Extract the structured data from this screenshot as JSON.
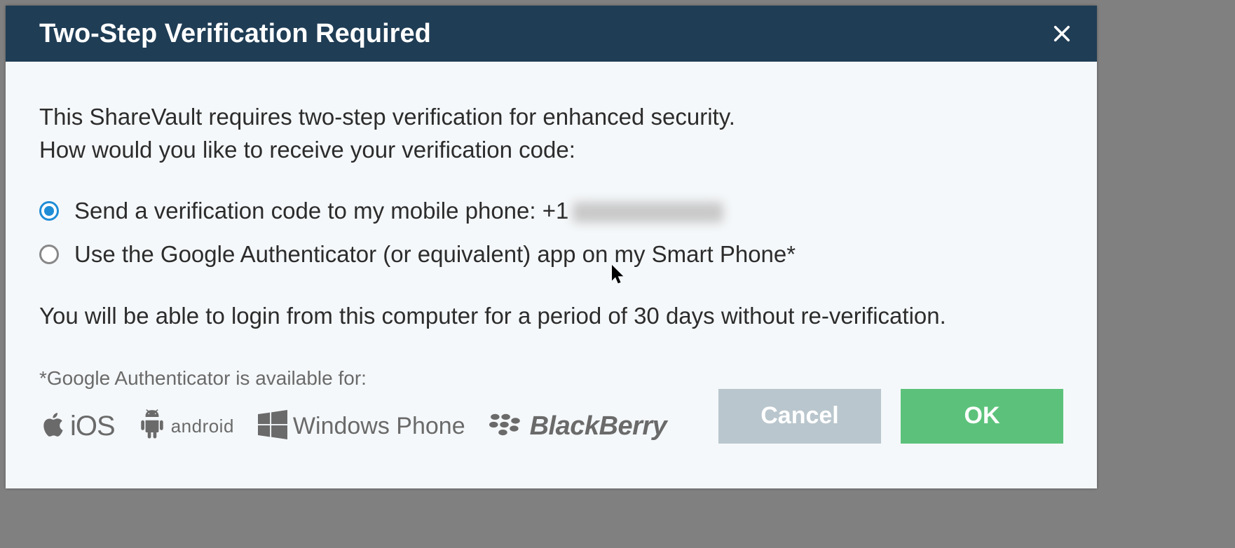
{
  "dialog": {
    "title": "Two-Step Verification Required",
    "intro_line1": "This ShareVault requires two-step verification for enhanced security.",
    "intro_line2": "How would you like to receive your verification code:",
    "options": {
      "sms": {
        "label_prefix": "Send a verification code to my mobile phone: ",
        "phone_prefix": "+1",
        "selected": true
      },
      "authenticator": {
        "label": "Use the Google Authenticator (or equivalent) app on my Smart Phone*",
        "selected": false
      }
    },
    "retention_text": "You will be able to login from this computer for a period of 30 days without re-verification.",
    "footnote": "*Google Authenticator is available for:",
    "platforms": {
      "ios": "iOS",
      "android": "android",
      "windows_phone": "Windows Phone",
      "blackberry": "BlackBerry"
    },
    "buttons": {
      "cancel": "Cancel",
      "ok": "OK"
    }
  }
}
